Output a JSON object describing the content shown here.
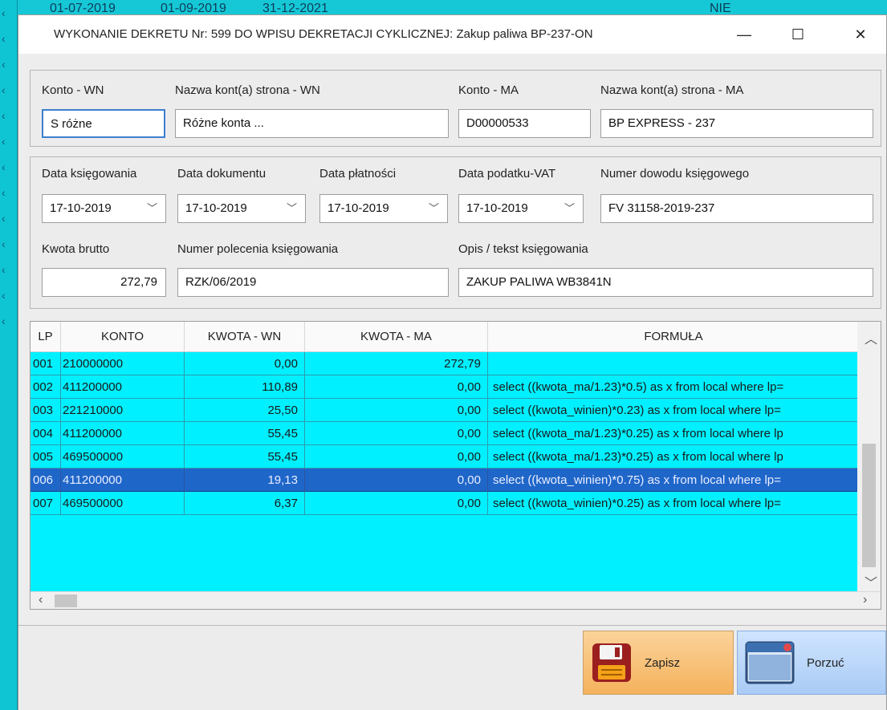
{
  "background": {
    "dates": [
      "01-07-2019",
      "01-09-2019",
      "31-12-2021"
    ],
    "flag": "NIE"
  },
  "dialog": {
    "title": "WYKONANIE DEKRETU Nr: 599 DO WPISU DEKRETACJI CYKLICZNEJ: Zakup paliwa BP-237-ON",
    "minimize": "—",
    "maximize": "☐",
    "close": "✕"
  },
  "accounts": {
    "konto_wn_label": "Konto - WN",
    "nazwa_wn_label": "Nazwa kont(a) strona - WN",
    "konto_ma_label": "Konto - MA",
    "nazwa_ma_label": "Nazwa kont(a) strona - MA",
    "konto_wn": "S różne",
    "nazwa_wn": "Różne konta ...",
    "konto_ma": "D00000533",
    "nazwa_ma": "BP EXPRESS - 237"
  },
  "dates": {
    "data_ksiegowania_label": "Data księgowania",
    "data_dokumentu_label": "Data dokumentu",
    "data_platnosci_label": "Data płatności",
    "data_vat_label": "Data podatku-VAT",
    "numer_dowodu_label": "Numer dowodu księgowego",
    "data_ksiegowania": "17-10-2019",
    "data_dokumentu": "17-10-2019",
    "data_platnosci": "17-10-2019",
    "data_vat": "17-10-2019",
    "numer_dowodu": "FV 31158-2019-237",
    "kwota_label": "Kwota brutto",
    "polecenie_label": "Numer polecenia księgowania",
    "opis_label": "Opis / tekst księgowania",
    "kwota": "272,79",
    "polecenie": "RZK/06/2019",
    "opis": "ZAKUP PALIWA WB3841N"
  },
  "grid": {
    "columns": [
      "LP",
      "KONTO",
      "KWOTA - WN",
      "KWOTA - MA",
      "FORMUŁA"
    ],
    "rows": [
      {
        "lp": "001",
        "konto": "210000000",
        "wn": "0,00",
        "ma": "272,79",
        "formula": ""
      },
      {
        "lp": "002",
        "konto": "411200000",
        "wn": "110,89",
        "ma": "0,00",
        "formula": "select ((kwota_ma/1.23)*0.5) as x from local where lp="
      },
      {
        "lp": "003",
        "konto": "221210000",
        "wn": "25,50",
        "ma": "0,00",
        "formula": "select ((kwota_winien)*0.23) as x from local where lp="
      },
      {
        "lp": "004",
        "konto": "411200000",
        "wn": "55,45",
        "ma": "0,00",
        "formula": "select ((kwota_ma/1.23)*0.25) as x from local where lp"
      },
      {
        "lp": "005",
        "konto": "469500000",
        "wn": "55,45",
        "ma": "0,00",
        "formula": "select ((kwota_ma/1.23)*0.25) as x from local where lp"
      },
      {
        "lp": "006",
        "konto": "411200000",
        "wn": "19,13",
        "ma": "0,00",
        "formula": "select ((kwota_winien)*0.75) as x from local where lp="
      },
      {
        "lp": "007",
        "konto": "469500000",
        "wn": "6,37",
        "ma": "0,00",
        "formula": "select ((kwota_winien)*0.25) as x from local where lp="
      }
    ],
    "selected_row": "006"
  },
  "buttons": {
    "save": "Zapisz",
    "cancel": "Porzuć"
  },
  "icons": {
    "save": "floppy-disk-icon",
    "cancel": "window-close-icon"
  },
  "colors": {
    "grid_background": "#00f0ff",
    "selection": "#1f66c9",
    "save_button": "#f4b25c",
    "cancel_button": "#a9cbf5"
  }
}
